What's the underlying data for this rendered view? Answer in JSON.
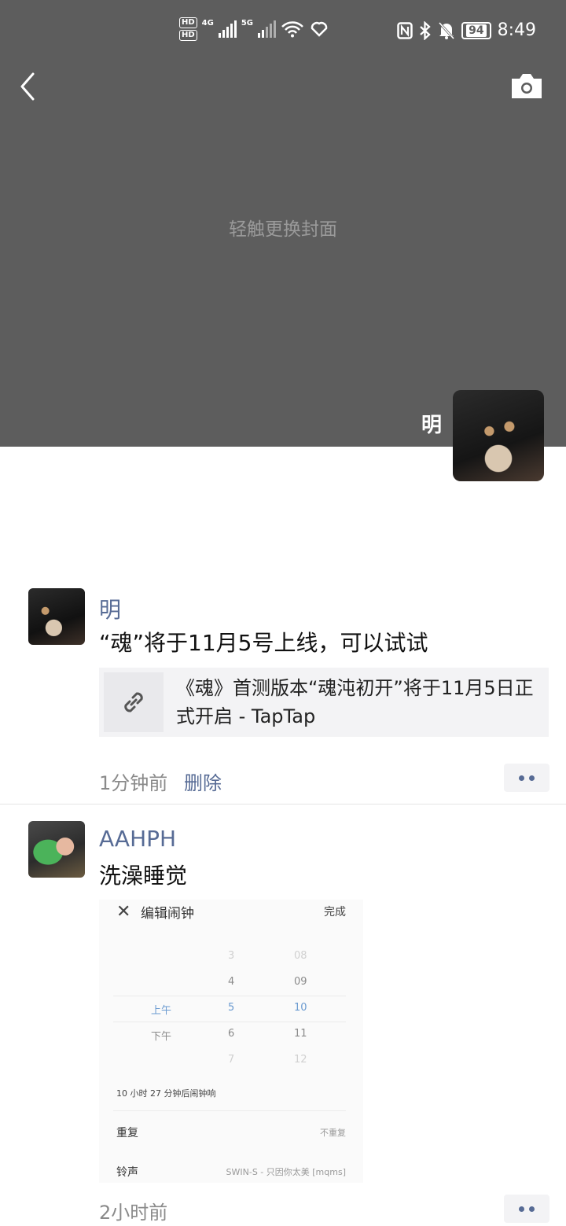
{
  "status_bar": {
    "hd1": "HD",
    "hd2": "HD",
    "net1": "4G",
    "net2": "5G",
    "battery": "94",
    "time": "8:49"
  },
  "cover": {
    "hint": "轻触更换封面",
    "owner_name": "明"
  },
  "posts": [
    {
      "user": "明",
      "text": "“魂”将于11月5号上线，可以试试",
      "link_title": "《魂》首测版本“魂沌初开”将于11月5日正式开启 - TapTap",
      "time": "1分钟前",
      "delete_label": "删除"
    },
    {
      "user": "AAHPH",
      "text": "洗澡睡觉",
      "time": "2小时前",
      "screenshot": {
        "title": "编辑闹钟",
        "done": "完成",
        "ampm": [
          "上午",
          "下午"
        ],
        "hours": [
          "3",
          "4",
          "5",
          "6",
          "7"
        ],
        "minutes": [
          "08",
          "09",
          "10",
          "11",
          "12"
        ],
        "note": "10 小时 27 分钟后闹钟响",
        "repeat_label": "重复",
        "repeat_value": "不重复",
        "ringtone_label": "铃声",
        "ringtone_value": "SWIN-S - 只因你太美 [mqms]"
      }
    }
  ],
  "icons": [
    "back-arrow-icon",
    "camera-icon",
    "link-icon",
    "more-dots-icon",
    "wifi-icon",
    "bluetooth-icon",
    "nfc-icon",
    "mute-bell-icon"
  ]
}
